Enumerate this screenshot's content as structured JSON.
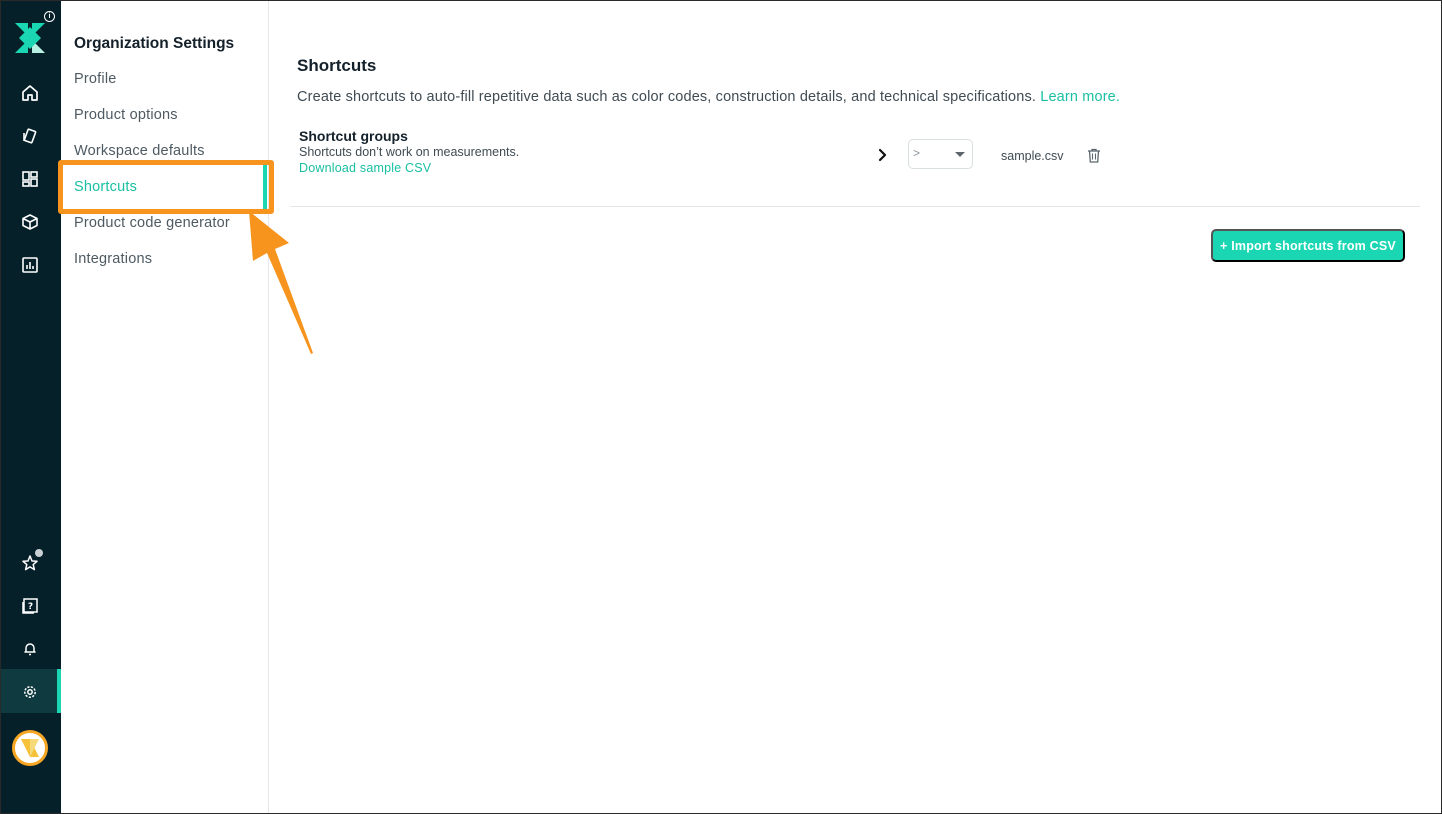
{
  "rail": {
    "icons": [
      "home-icon",
      "tag-icon",
      "grid-icon",
      "box-icon",
      "chart-icon",
      "star-icon",
      "help-icon",
      "bell-icon",
      "gear-icon"
    ],
    "active": "gear-icon"
  },
  "sidebar": {
    "title": "Organization Settings",
    "items": [
      {
        "label": "Profile"
      },
      {
        "label": "Product options"
      },
      {
        "label": "Workspace defaults"
      },
      {
        "label": "Shortcuts"
      },
      {
        "label": "Product code generator"
      },
      {
        "label": "Integrations"
      }
    ],
    "active_index": 3
  },
  "main": {
    "title": "Shortcuts",
    "description": "Create shortcuts to auto-fill repetitive data such as color codes, construction details, and technical specifications.",
    "learn_more": "Learn more.",
    "shortcut_groups": {
      "title": "Shortcut groups",
      "subtitle": "Shortcuts don’t work on measurements.",
      "download_link": "Download sample CSV",
      "select_value": ">",
      "file_name": "sample.csv"
    },
    "import_button": "+ Import shortcuts from CSV"
  },
  "colors": {
    "accent": "#1ad6b3",
    "rail_bg": "#06202a",
    "highlight": "#f7941d"
  }
}
